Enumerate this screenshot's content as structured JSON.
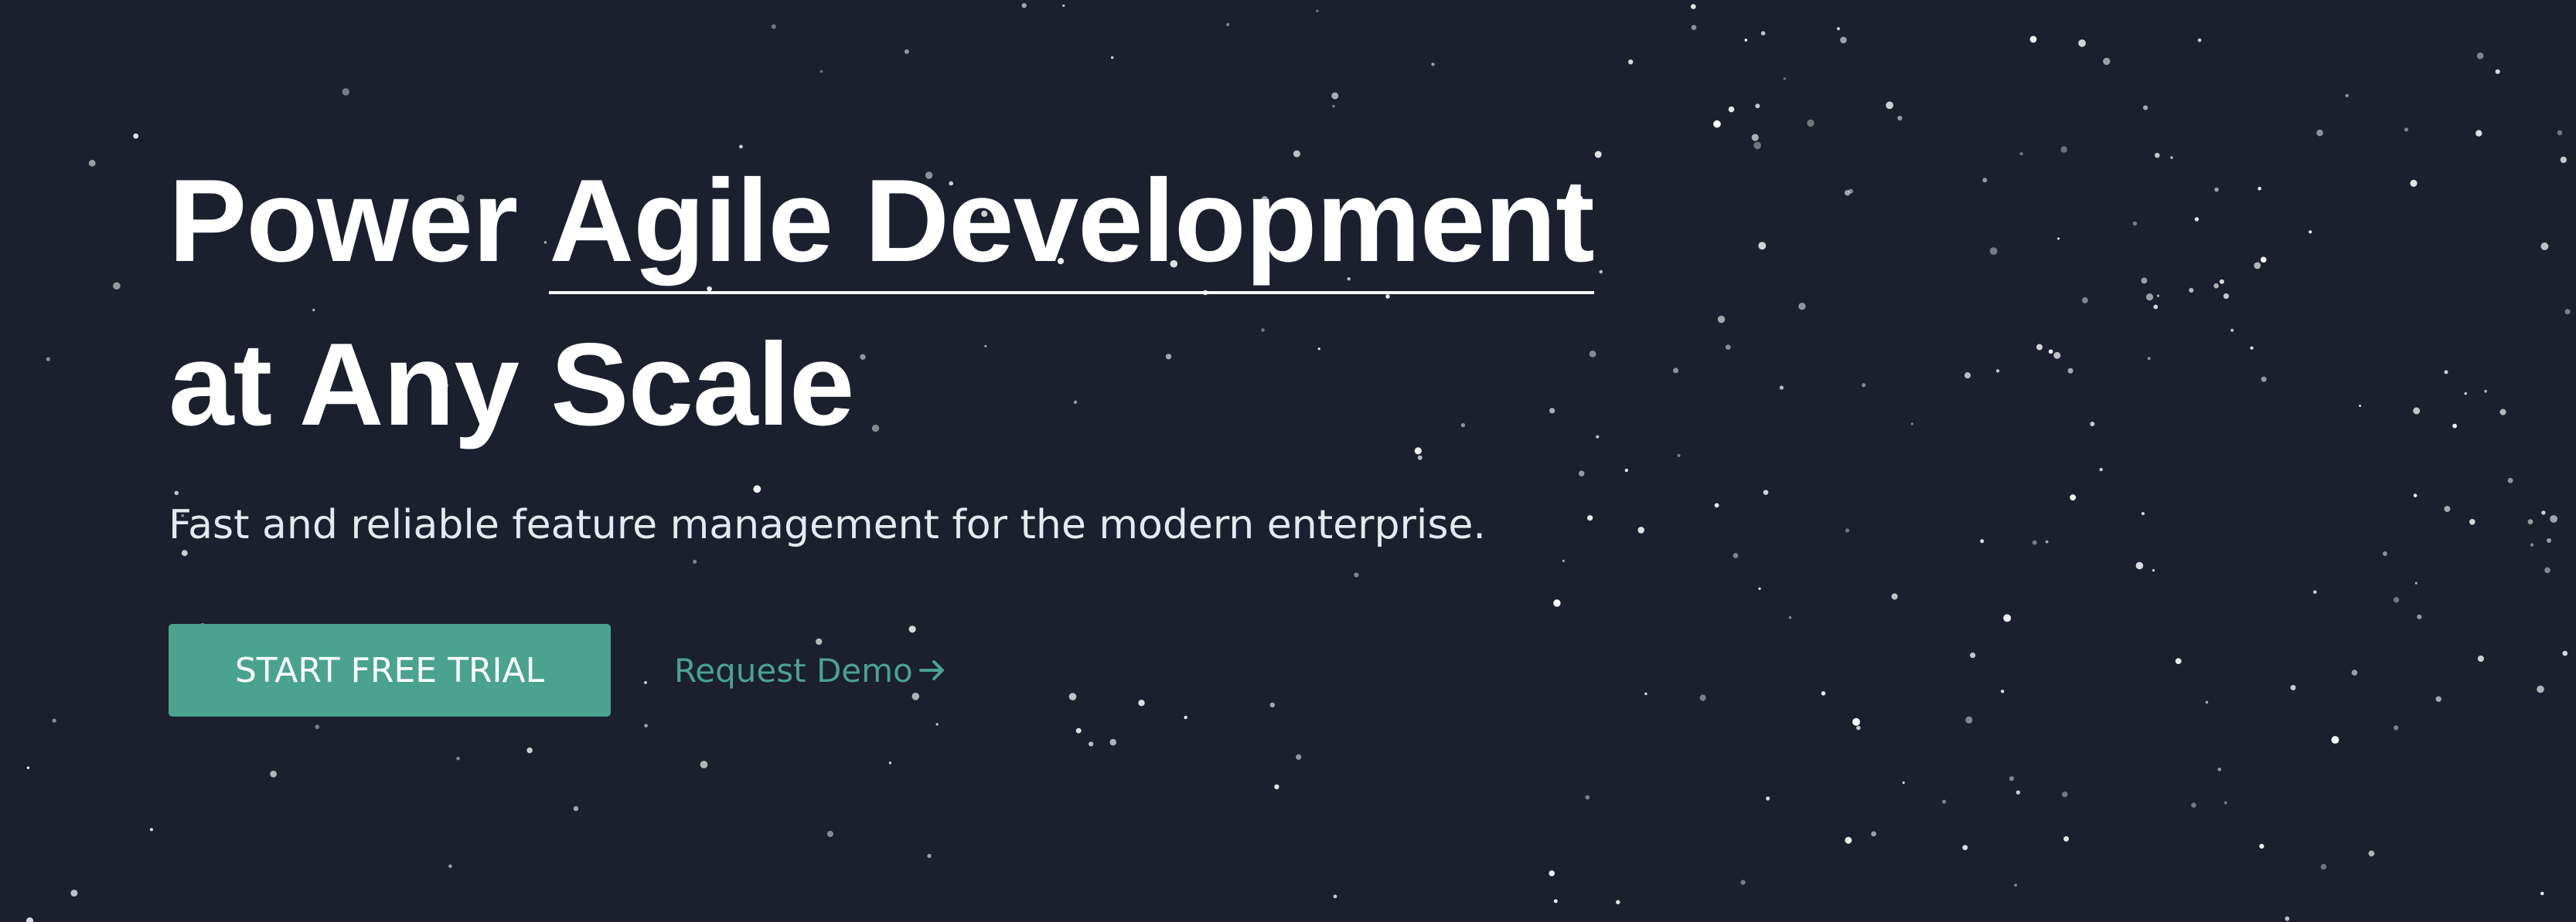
{
  "hero": {
    "headline_line1_prefix": "Power ",
    "headline_line1_underlined": "Agile Development",
    "headline_line2": "at Any Scale",
    "subtitle": "Fast and reliable feature management for the modern enterprise.",
    "primary_cta_label": "START FREE TRIAL",
    "secondary_cta_label": "Request Demo",
    "secondary_cta_icon": "arrow-right-icon"
  },
  "colors": {
    "background": "#1b1f2e",
    "accent": "#49a38f",
    "headline": "#ffffff",
    "subtitle": "#e6e9ef"
  }
}
